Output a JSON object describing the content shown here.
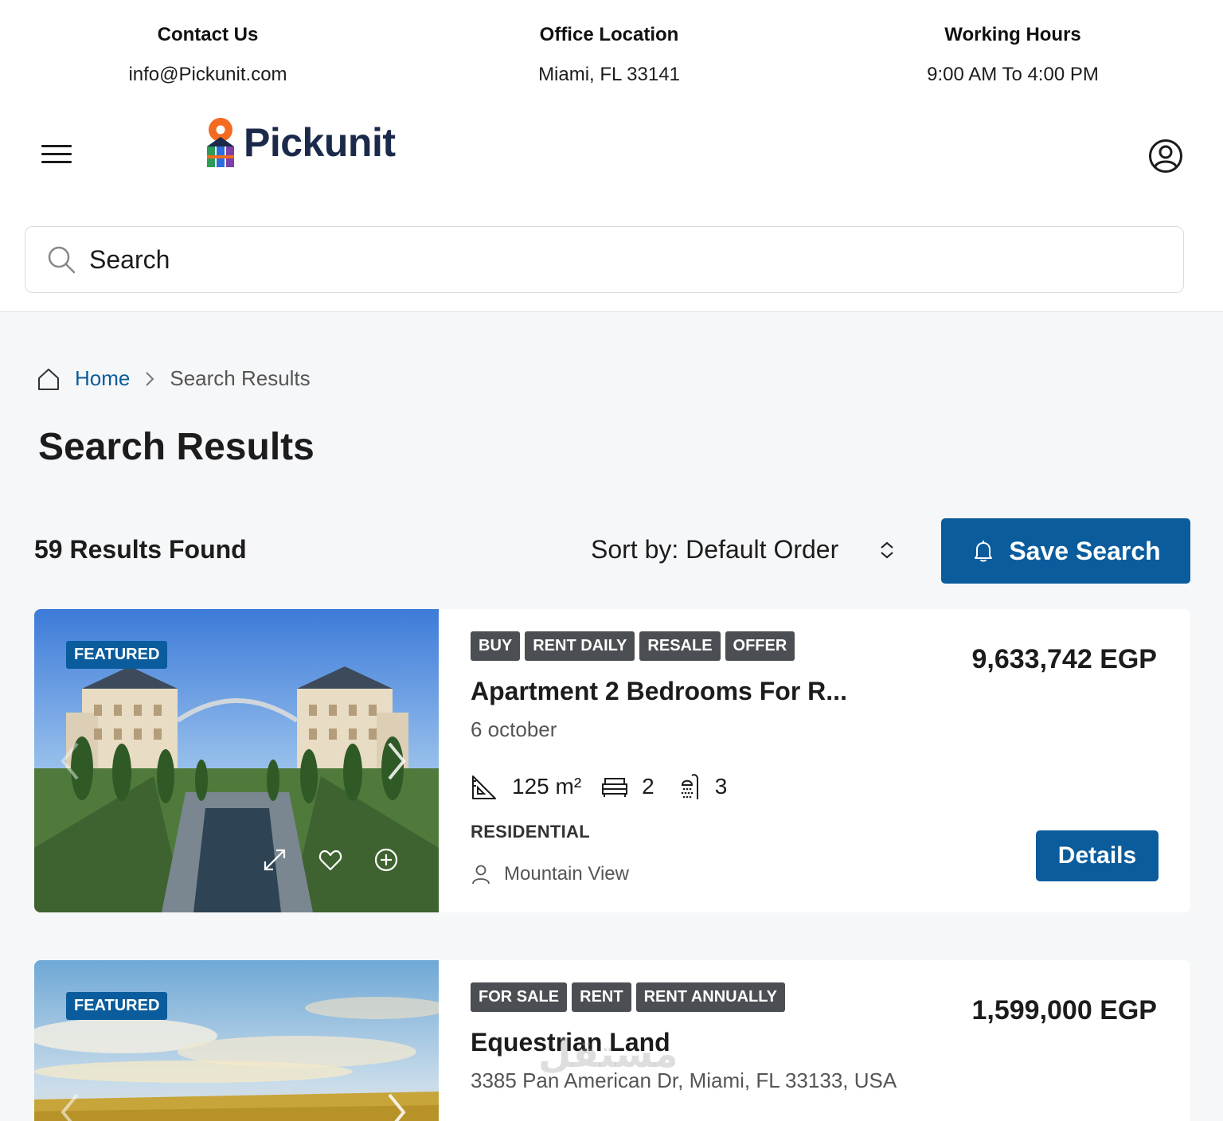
{
  "contact": {
    "contact_title": "Contact Us",
    "contact_value": "info@Pickunit.com",
    "office_title": "Office Location",
    "office_value": "Miami, FL 33141",
    "hours_title": "Working Hours",
    "hours_value": "9:00 AM To 4:00 PM"
  },
  "header": {
    "logo_text": "Pickunit",
    "menu_icon": "hamburger-icon",
    "user_icon": "user-circle-icon"
  },
  "search": {
    "placeholder": "Search",
    "icon": "search-icon"
  },
  "breadcrumb": {
    "home_label": "Home",
    "current_label": "Search Results"
  },
  "page": {
    "title": "Search Results",
    "results_count": "59 Results Found",
    "sort_label": "Sort by: Default Order",
    "save_search_label": "Save Search"
  },
  "listings": [
    {
      "featured_label": "FEATURED",
      "tags": [
        "BUY",
        "RENT DAILY",
        "RESALE",
        "OFFER"
      ],
      "title": "Apartment 2 Bedrooms For R...",
      "location": "6 october",
      "area": "125 m²",
      "bedrooms": "2",
      "bathrooms": "3",
      "category": "RESIDENTIAL",
      "agent": "Mountain View",
      "price": "9,633,742 EGP",
      "details_label": "Details"
    },
    {
      "featured_label": "FEATURED",
      "tags": [
        "FOR SALE",
        "RENT",
        "RENT ANNUALLY"
      ],
      "title": "Equestrian Land",
      "location": "3385 Pan American Dr, Miami, FL 33133, USA",
      "price": "1,599,000 EGP"
    }
  ],
  "watermark": "مستقل",
  "colors": {
    "primary": "#0a5c9c",
    "tag_bg": "#4b4e52",
    "page_bg": "#f6f7f9",
    "logo_text": "#1b2a4a"
  }
}
